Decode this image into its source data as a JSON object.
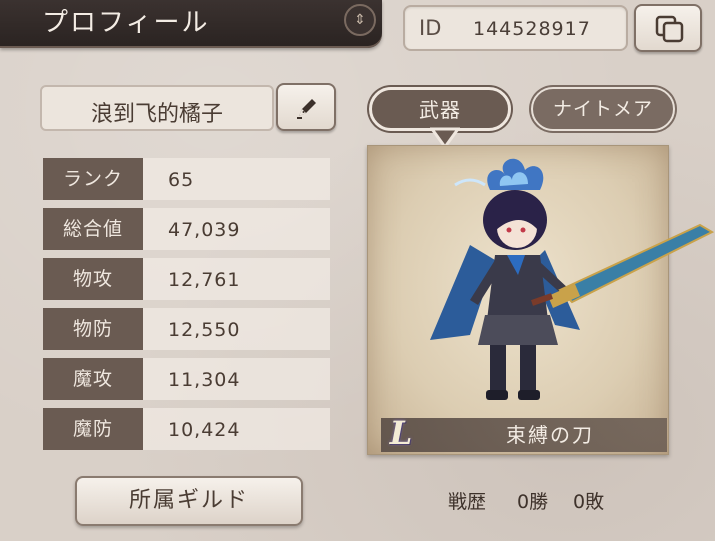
{
  "header": {
    "title": "プロフィール",
    "ornament_icon": "chevron-up-down-icon"
  },
  "id_box": {
    "label": "ID",
    "value": "144528917",
    "copy_icon": "copy-icon"
  },
  "profile": {
    "name": "浪到飞的橘子",
    "edit_icon": "pen-icon"
  },
  "stats": [
    {
      "label": "ランク",
      "value": "65"
    },
    {
      "label": "総合値",
      "value": "47,039"
    },
    {
      "label": "物攻",
      "value": "12,761"
    },
    {
      "label": "物防",
      "value": "12,550"
    },
    {
      "label": "魔攻",
      "value": "11,304"
    },
    {
      "label": "魔防",
      "value": "10,424"
    }
  ],
  "guild_button": {
    "label": "所属ギルド"
  },
  "tabs": [
    {
      "label": "武器",
      "active": true
    },
    {
      "label": "ナイトメア",
      "active": false
    }
  ],
  "weapon": {
    "rarity": "L",
    "name": "束縛の刀"
  },
  "record": {
    "label": "戦歴",
    "wins": "0勝",
    "losses": "0敗"
  }
}
